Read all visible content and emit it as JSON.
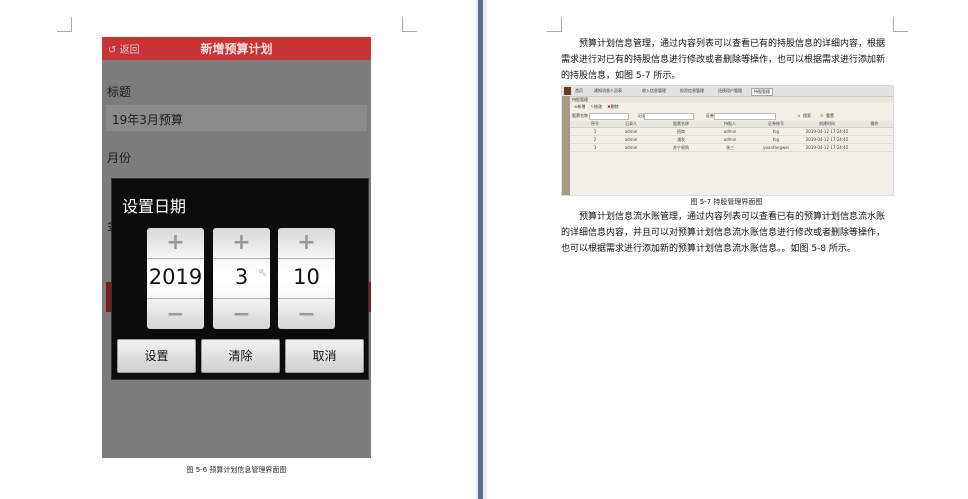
{
  "phone": {
    "back_label": "返回",
    "title": "新增预算计划",
    "label_title": "标题",
    "title_value": "19年3月预算",
    "label_month": "月份",
    "label_amount": "金"
  },
  "dialog": {
    "title": "设置日期",
    "year": "2019",
    "month": "3",
    "day": "10",
    "plus": "+",
    "minus": "−",
    "buttons": [
      "设置",
      "清除",
      "取消"
    ]
  },
  "left_caption": "图 5-6 预算计划信息管理界面图",
  "paragraph1": "预算计划信息管理，通过内容列表可以查看已有的持股信息的详细内容，根据需求进行对已有的持股信息进行修改或者删除等操作，也可以根据需求进行添加新的持股信息，如图 5-7 所示。",
  "screenshot": {
    "tabs": [
      "首页",
      "通知消息人员表",
      "收入信息管理",
      "投资信息管理",
      "还债用户管理",
      "持股管理"
    ],
    "toolbar": [
      "新增",
      "修改",
      "删除"
    ],
    "search": {
      "label1": "股票名称",
      "label2": "记录人",
      "placeholder2": "请选择",
      "label3": "证券账号",
      "placeholder3": "请选择类型",
      "btn": "搜索",
      "btn2": "重置"
    },
    "section": "持股管理",
    "columns": [
      "",
      "序号",
      "记录人",
      "股票名称",
      "持股人",
      "证券账号",
      "创建时间",
      "操作"
    ],
    "rows": [
      [
        "",
        "1",
        "admin",
        "招商",
        "admin",
        "fcg",
        "2019-04-12 17:24:42",
        ""
      ],
      [
        "",
        "2",
        "admin",
        "浦发",
        "admin",
        "fcg",
        "2019-04-12 17:24:42",
        ""
      ],
      [
        "",
        "3",
        "admin",
        "苏宁易购",
        "张三",
        "yuanfangwei",
        "2019-04-12 17:24:42",
        ""
      ]
    ]
  },
  "right_caption": "图 5-7 持股管理界面图",
  "paragraph2": "预算计划信息流水账管理，通过内容列表可以查看已有的预算计划信息流水账的详细信息内容，并且可以对预算计划信息流水账信息进行修改或者删除等操作，也可以根据需求进行添加新的预算计划信息流水账信息。。如图 5-8 所示。"
}
